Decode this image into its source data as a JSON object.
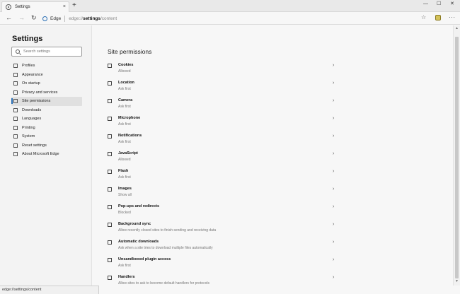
{
  "tab": {
    "title": "Settings",
    "close": "×"
  },
  "new_tab": "+",
  "window": {
    "minimize": "—",
    "maximize": "☐",
    "close": "✕"
  },
  "nav": {
    "back": "←",
    "forward": "→",
    "refresh": "↻"
  },
  "address": {
    "brand": "Edge",
    "url_host": "edge://",
    "url_path": "settings",
    "url_tail": "/content"
  },
  "toolbar": {
    "favorite": "☆",
    "more": "···"
  },
  "sidebar": {
    "title": "Settings",
    "search_placeholder": "Search settings",
    "items": [
      {
        "label": "Profiles",
        "icon": "person-icon"
      },
      {
        "label": "Appearance",
        "icon": "palette-icon"
      },
      {
        "label": "On startup",
        "icon": "power-icon"
      },
      {
        "label": "Privacy and services",
        "icon": "lock-icon"
      },
      {
        "label": "Site permissions",
        "icon": "grid-icon",
        "active": true
      },
      {
        "label": "Downloads",
        "icon": "download-icon"
      },
      {
        "label": "Languages",
        "icon": "language-icon"
      },
      {
        "label": "Printing",
        "icon": "printer-icon"
      },
      {
        "label": "System",
        "icon": "computer-icon"
      },
      {
        "label": "Reset settings",
        "icon": "reset-icon"
      },
      {
        "label": "About Microsoft Edge",
        "icon": "edge-icon"
      }
    ]
  },
  "main": {
    "section_title": "Site permissions",
    "chevron": "›",
    "permissions": [
      {
        "name": "Cookies",
        "status": "Allowed",
        "icon": "cookie-icon"
      },
      {
        "name": "Location",
        "status": "Ask first",
        "icon": "location-pin-icon"
      },
      {
        "name": "Camera",
        "status": "Ask first",
        "icon": "camera-icon"
      },
      {
        "name": "Microphone",
        "status": "Ask first",
        "icon": "microphone-icon"
      },
      {
        "name": "Notifications",
        "status": "Ask first",
        "icon": "bell-icon"
      },
      {
        "name": "JavaScript",
        "status": "Allowed",
        "icon": "javascript-icon"
      },
      {
        "name": "Flash",
        "status": "Ask first",
        "icon": "flash-icon"
      },
      {
        "name": "Images",
        "status": "Show all",
        "icon": "image-icon"
      },
      {
        "name": "Pop-ups and redirects",
        "status": "Blocked",
        "icon": "popup-icon"
      },
      {
        "name": "Background sync",
        "status": "Allow recently closed sites to finish sending and receiving data",
        "icon": "sync-icon"
      },
      {
        "name": "Automatic downloads",
        "status": "Ask when a site tries to download multiple files automatically",
        "icon": "download-icon"
      },
      {
        "name": "Unsandboxed plugin access",
        "status": "Ask first",
        "icon": "plugin-icon"
      },
      {
        "name": "Handlers",
        "status": "Allow sites to ask to become default handlers for protocols",
        "icon": "handler-icon"
      }
    ]
  },
  "status_bar": {
    "text": "edge://settings/content"
  },
  "scrollbar": {
    "up": "▲",
    "down": "▼"
  }
}
